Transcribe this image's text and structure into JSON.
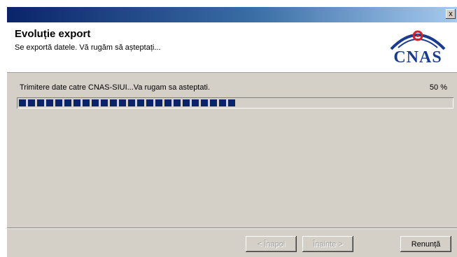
{
  "window": {
    "close_glyph": "x"
  },
  "header": {
    "title": "Evoluție export",
    "subtitle": "Se exportă datele. Vă rugăm să așteptați...",
    "logo_text": "CNAS",
    "logo_icon": "cnas-logo-icon"
  },
  "progress": {
    "status_text": "Trimitere date catre CNAS-SIUI...Va rugam sa asteptati.",
    "percent_label": "50 %",
    "value": 0.5,
    "fill_color": "#0a246a"
  },
  "buttons": {
    "back_label": "< Înapoi",
    "next_label": "Înainte >",
    "cancel_label": "Renunță"
  },
  "colors": {
    "title_bar": "#0a246a",
    "dialog_bg": "#d4d0c8",
    "logo_blue": "#1a3c8f",
    "logo_red": "#d4232a"
  }
}
